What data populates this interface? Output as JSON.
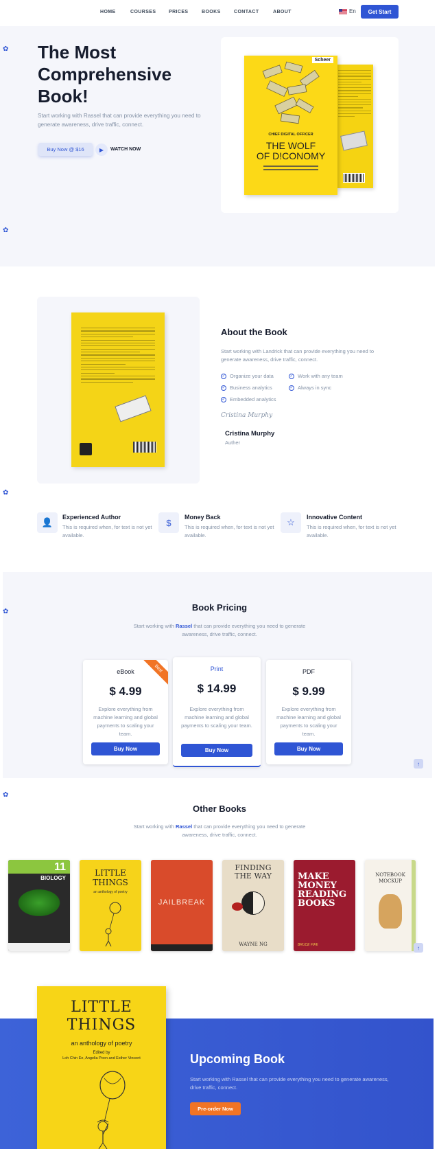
{
  "nav": {
    "links": [
      "HOME",
      "COURSES",
      "PRICES",
      "BOOKS",
      "CONTACT",
      "ABOUT"
    ],
    "lang": "En",
    "cta": "Get Start"
  },
  "hero": {
    "title": "The Most Comprehensive Book!",
    "desc": "Start working with Rassel that can provide everything you need to generate awareness, drive traffic, connect.",
    "buy_label": "Buy Now @ $16",
    "watch_label": "WATCH NOW",
    "book": {
      "publisher": "Scheer",
      "subtitle": "CHIEF DIGITAL OFFICER",
      "title_line1": "THE WOLF",
      "title_line2": "OF D!CONOMY"
    }
  },
  "about": {
    "title": "About the Book",
    "desc": "Start working with Landrick that can provide everything you need to generate awareness, drive traffic, connect.",
    "features": [
      "Organize your data",
      "Work with any team",
      "Business analytics",
      "Always in sync",
      "Embedded analytics"
    ],
    "signature": "Cristina Murphy",
    "author_name": "Cristina Murphy",
    "author_role": "Auther"
  },
  "highlights": [
    {
      "icon": "user-icon",
      "title": "Experienced Author",
      "desc": "This is required when, for text is not yet available."
    },
    {
      "icon": "dollar-icon",
      "title": "Money Back",
      "desc": "This is required when, for text is not yet available."
    },
    {
      "icon": "star-icon",
      "title": "Innovative Content",
      "desc": "This is required when, for text is not yet available."
    }
  ],
  "pricing": {
    "title": "Book Pricing",
    "sub_before": "Start working with ",
    "sub_brand": "Rassel",
    "sub_after": " that can provide everything you need to generate awareness, drive traffic, connect.",
    "plans": [
      {
        "name": "eBook",
        "price": "$ 4.99",
        "desc": "Explore everything from machine learning and global payments to scaling your team.",
        "button": "Buy Now",
        "badge": "Best"
      },
      {
        "name": "Print",
        "price": "$ 14.99",
        "desc": "Explore everything from machine learning and global payments to scaling your team.",
        "button": "Buy Now"
      },
      {
        "name": "PDF",
        "price": "$ 9.99",
        "desc": "Explore everything from machine learning and global payments to scaling your team.",
        "button": "Buy Now"
      }
    ]
  },
  "other_books": {
    "title": "Other Books",
    "sub_before": "Start working with ",
    "sub_brand": "Rassel",
    "sub_after": " that can provide everything you need to generate awareness, drive traffic, connect.",
    "books": [
      {
        "title": "BIOLOGY",
        "top": "11",
        "color": "#2a2a2a"
      },
      {
        "title": "LITTLE THINGS",
        "sub": "an anthology of poetry",
        "color": "#f6d31a"
      },
      {
        "title": "JAILBREAK",
        "color": "#d94b2b"
      },
      {
        "title": "FINDING THE WAY",
        "sub": "WAYNE NG",
        "color": "#e8ddc8"
      },
      {
        "title": "MAKE MONEY READING BOOKS",
        "sub": "BRUCE FIFE",
        "color": "#9b1b2f"
      },
      {
        "title": "NOTEBOOK MOCKUP",
        "color": "#f6f2ea"
      }
    ]
  },
  "upcoming": {
    "title": "Upcoming Book",
    "desc": "Start working with Rassel that can provide everything you need to generate awareness, drive traffic, connect.",
    "button": "Pre-order Now",
    "book": {
      "title_line1": "LITTLE",
      "title_line2": "THINGS",
      "subtitle": "an anthology of poetry",
      "edited": "Edited by",
      "editors": "Loh Chin Ee, Angelia Poon and Esther Vincent"
    }
  }
}
